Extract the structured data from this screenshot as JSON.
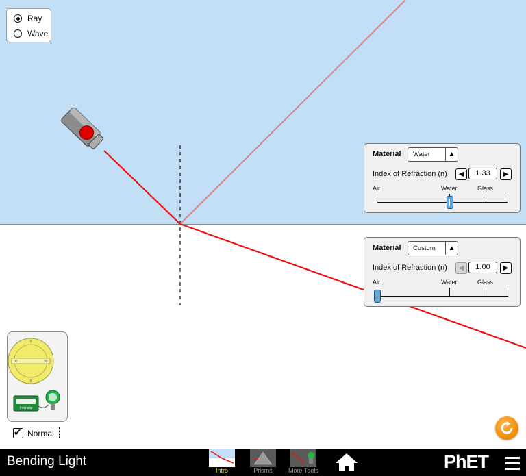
{
  "app_title": "Bending Light",
  "mode_panel": {
    "options": [
      {
        "label": "Ray",
        "selected": true
      },
      {
        "label": "Wave",
        "selected": false
      }
    ]
  },
  "top_material": {
    "title": "Material",
    "selected": "Water",
    "index_label": "Index of Refraction (n)",
    "index_value": "1.33",
    "index_numeric": 1.33,
    "slider_labels": [
      "Air",
      "Water",
      "Glass"
    ],
    "decrement_enabled": true
  },
  "bottom_material": {
    "title": "Material",
    "selected": "Custom",
    "index_label": "Index of Refraction (n)",
    "index_value": "1.00",
    "index_numeric": 1.0,
    "slider_labels": [
      "Air",
      "Water",
      "Glass"
    ],
    "decrement_enabled": false
  },
  "toolbox": {
    "intensity_label": "Intensity"
  },
  "normal_checkbox": {
    "label": "Normal",
    "checked": true
  },
  "nav": {
    "screens": [
      {
        "label": "Intro",
        "active": true
      },
      {
        "label": "Prisms",
        "active": false
      },
      {
        "label": "More Tools",
        "active": false
      }
    ],
    "brand": "PhET"
  },
  "colors": {
    "top_medium": "#c3dff5",
    "bottom_medium": "#ffffff",
    "laser_beam": "#ee1111",
    "reflected_beam": "#d48a92",
    "reset_orange": "#f08a00",
    "active_tab": "#f3e400"
  }
}
